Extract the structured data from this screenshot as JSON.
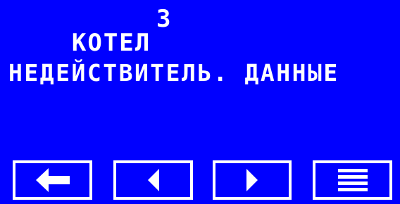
{
  "display": {
    "title": "КОТЕЛ",
    "number": "3",
    "message": "НЕДЕЙСТВИТЕЛЬ. ДАННЫЕ"
  },
  "buttons": [
    {
      "icon": "back-arrow-icon"
    },
    {
      "icon": "triangle-left-icon"
    },
    {
      "icon": "triangle-right-icon"
    },
    {
      "icon": "menu-icon"
    }
  ],
  "colors": {
    "background": "#0000ff",
    "foreground": "#ffffff"
  }
}
